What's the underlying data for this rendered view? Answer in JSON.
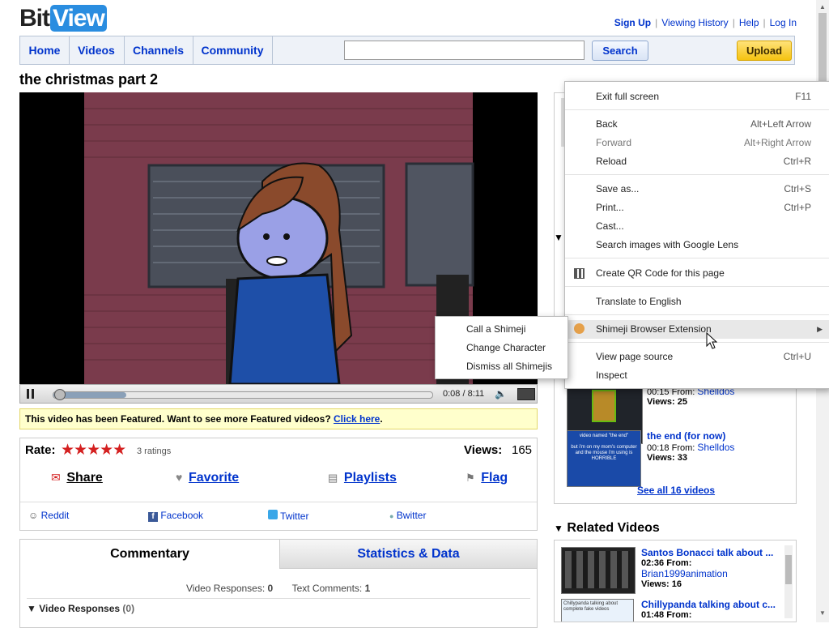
{
  "logo": {
    "bit": "Bit",
    "view": "View"
  },
  "toplinks": {
    "signup": "Sign Up",
    "history": "Viewing History",
    "help": "Help",
    "login": "Log In"
  },
  "nav": {
    "home": "Home",
    "videos": "Videos",
    "channels": "Channels",
    "community": "Community"
  },
  "search": {
    "button": "Search",
    "value": ""
  },
  "upload": "Upload",
  "video": {
    "title": "the christmas part 2",
    "time": "0:08 / 8:11",
    "progress": 0.016
  },
  "featured": {
    "text": "This video has been Featured. Want to see more Featured videos? ",
    "link": "Click here",
    "end": "."
  },
  "rating": {
    "label": "Rate:",
    "stars": "★★★★★",
    "count": "3 ratings",
    "views_label": "Views:",
    "views": "165"
  },
  "actions": {
    "share": "Share",
    "favorite": "Favorite",
    "playlists": "Playlists",
    "flag": "Flag"
  },
  "social": {
    "reddit": "Reddit",
    "facebook": "Facebook",
    "twitter": "Twitter",
    "bwitter": "Bwitter"
  },
  "tabs": {
    "commentary": "Commentary",
    "stats": "Statistics & Data"
  },
  "responses": {
    "vr_label": "Video Responses:",
    "vr": "0",
    "tc_label": "Text Comments:",
    "tc": "1",
    "header": "Video Responses",
    "header_count": "(0)"
  },
  "sidebar": {
    "more_videos": [
      {
        "time": "00:15",
        "from": "From:",
        "user": "Shelldos",
        "views_label": "Views:",
        "views": "25",
        "title": ""
      },
      {
        "title": "the end (for now)",
        "time": "00:18",
        "from": "From:",
        "user": "Shelldos",
        "views_label": "Views:",
        "views": "33",
        "thumb_text": "video named \"the end\"\n\nbut i'm on my mom's computer and the mouse i'm using is HORRIBLE"
      }
    ],
    "see_all": "See all 16 videos",
    "related_header": "Related Videos",
    "related": [
      {
        "title": "Santos Bonacci talk about ...",
        "time": "02:36",
        "from": "From:",
        "user": "Brian1999animation",
        "views_label": "Views:",
        "views": "16"
      },
      {
        "title": "Chillypanda talking about c...",
        "time": "01:48",
        "from": "From:",
        "thumb_text": "Chillypanda talking about complete fake videos"
      }
    ]
  },
  "context_menu": {
    "items": [
      {
        "label": "Exit full screen",
        "shortcut": "F11"
      },
      {
        "label": "Back",
        "shortcut": "Alt+Left Arrow"
      },
      {
        "label": "Forward",
        "shortcut": "Alt+Right Arrow"
      },
      {
        "label": "Reload",
        "shortcut": "Ctrl+R"
      },
      {
        "label": "Save as...",
        "shortcut": "Ctrl+S"
      },
      {
        "label": "Print...",
        "shortcut": "Ctrl+P"
      },
      {
        "label": "Cast...",
        "shortcut": ""
      },
      {
        "label": "Search images with Google Lens",
        "shortcut": ""
      },
      {
        "label": "Create QR Code for this page",
        "shortcut": ""
      },
      {
        "label": "Translate to English",
        "shortcut": ""
      },
      {
        "label": "Shimeji Browser Extension",
        "shortcut": ""
      },
      {
        "label": "View page source",
        "shortcut": "Ctrl+U"
      },
      {
        "label": "Inspect",
        "shortcut": ""
      }
    ]
  },
  "submenu": {
    "items": [
      "Call a Shimeji",
      "Change Character",
      "Dismiss all Shimejis"
    ]
  }
}
